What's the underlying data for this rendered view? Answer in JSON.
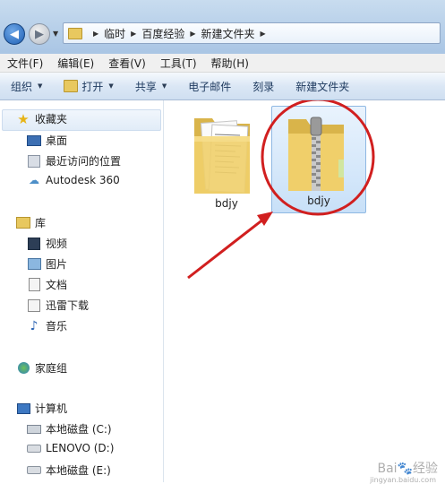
{
  "address_bar": {
    "breadcrumbs": [
      "临时",
      "百度经验",
      "新建文件夹"
    ]
  },
  "menu": [
    "文件(F)",
    "编辑(E)",
    "查看(V)",
    "工具(T)",
    "帮助(H)"
  ],
  "toolbar": {
    "organize": "组织",
    "open": "打开",
    "share": "共享",
    "email": "电子邮件",
    "burn": "刻录",
    "new_folder": "新建文件夹"
  },
  "sidebar": {
    "favorites": "收藏夹",
    "favorites_items": [
      "桌面",
      "最近访问的位置",
      "Autodesk 360"
    ],
    "libraries": "库",
    "library_items": [
      "视频",
      "图片",
      "文档",
      "迅雷下载",
      "音乐"
    ],
    "homegroup": "家庭组",
    "computer": "计算机",
    "computer_items": [
      "本地磁盘 (C:)",
      "LENOVO (D:)",
      "本地磁盘 (E:)"
    ]
  },
  "files": [
    {
      "name": "bdjy",
      "type": "folder",
      "selected": false
    },
    {
      "name": "bdjy",
      "type": "zip",
      "selected": true
    }
  ],
  "watermark": {
    "brand": "Bai",
    "brand2": "经验",
    "url": "jingyan.baidu.com"
  },
  "colors": {
    "annotation": "#d11f1f",
    "folder": "#e9c75f",
    "selection": "#c8e0f8"
  }
}
